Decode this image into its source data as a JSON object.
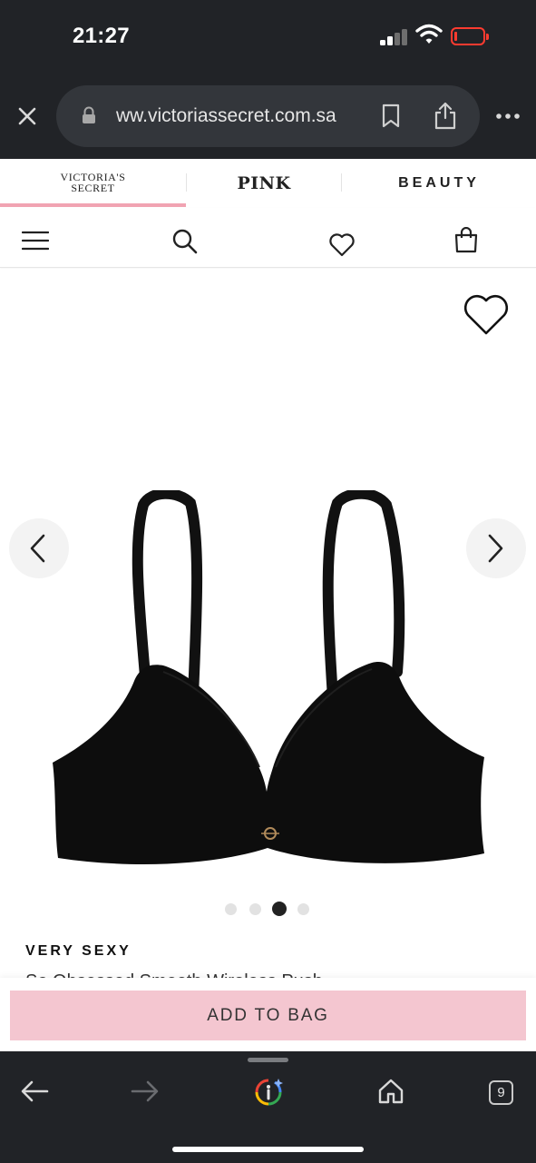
{
  "status_bar": {
    "time": "21:27"
  },
  "browser": {
    "url": "victoriassecret.com.sa",
    "url_visible": "ww.victoriassecret.com.sa"
  },
  "brand_tabs": [
    {
      "label_line1": "VICTORIA'S",
      "label_line2": "SECRET",
      "active": true
    },
    {
      "label": "PINK"
    },
    {
      "label": "BEAUTY"
    }
  ],
  "product": {
    "brand": "VERY SEXY",
    "name": "So Obsessed Smooth Wireless Push",
    "image_icon": "black-wireless-push-up-bra-image",
    "carousel": {
      "total_images": 4,
      "active_index": 3
    }
  },
  "actions": {
    "add_to_bag": "ADD TO BAG"
  },
  "toolbar": {
    "tab_count": "9"
  },
  "colors": {
    "chrome_bg": "#212327",
    "urlbar_bg": "#33363b",
    "vs_pink_accent": "#f1a3b2",
    "add_to_bag_bg": "#f4c6d0",
    "battery_low": "#ff3b30"
  }
}
